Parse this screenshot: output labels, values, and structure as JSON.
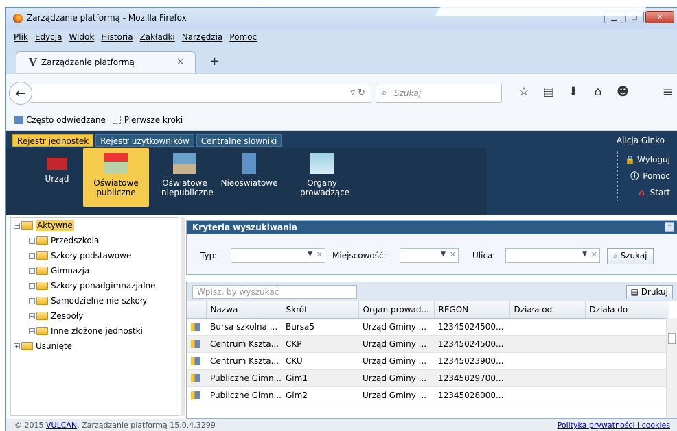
{
  "window": {
    "title": "Zarządzanie platformą - Mozilla Firefox"
  },
  "menubar": [
    "Plik",
    "Edycja",
    "Widok",
    "Historia",
    "Zakładki",
    "Narzędzia",
    "Pomoc"
  ],
  "tab": {
    "favicon": "V",
    "label": "Zarządzanie platformą",
    "close": "×",
    "new": "+"
  },
  "search": {
    "placeholder": "Szukaj"
  },
  "bookmarks": {
    "item1": "Często odwiedzane",
    "item2": "Pierwsze kroki"
  },
  "app": {
    "tabs": [
      "Rejestr jednostek",
      "Rejestr użytkowników",
      "Centralne słowniki"
    ],
    "user": "Alicja Ginko",
    "tiles": [
      "Urząd",
      "Oświatowe publiczne",
      "Oświatowe niepubliczne",
      "Nieoświatowe",
      "Organy prowadzące"
    ],
    "links": {
      "logout": "Wyloguj",
      "help": "Pomoc",
      "start": "Start"
    }
  },
  "tree": [
    {
      "label": "Aktywne",
      "level": 0,
      "sign": "−"
    },
    {
      "label": "Przedszkola",
      "level": 1,
      "sign": "+"
    },
    {
      "label": "Szkoły podstawowe",
      "level": 1,
      "sign": "+"
    },
    {
      "label": "Gimnazja",
      "level": 1,
      "sign": "+"
    },
    {
      "label": "Szkoły ponadgimnazjalne",
      "level": 1,
      "sign": "+"
    },
    {
      "label": "Samodzielne nie-szkoły",
      "level": 1,
      "sign": "+"
    },
    {
      "label": "Zespoły",
      "level": 1,
      "sign": "+"
    },
    {
      "label": "Inne złożone jednostki",
      "level": 1,
      "sign": "+"
    },
    {
      "label": "Usunięte",
      "level": 0,
      "sign": "+"
    }
  ],
  "criteria": {
    "title": "Kryteria wyszukiwania",
    "type_label": "Typ:",
    "city_label": "Miejscowość:",
    "street_label": "Ulica:",
    "search_btn": "Szukaj"
  },
  "grid": {
    "filter_placeholder": "Wpisz, by wyszukać",
    "print": "Drukuj",
    "columns": [
      "Nazwa",
      "Skrót",
      "Organ prowad...",
      "REGON",
      "Działa od",
      "Działa do"
    ],
    "rows": [
      [
        "Bursa szkolna ...",
        "Bursa5",
        "Urząd Gminy ...",
        "12345024500...",
        "",
        ""
      ],
      [
        "Centrum Kszta...",
        "CKP",
        "Urząd Gminy ...",
        "12345024500...",
        "",
        ""
      ],
      [
        "Centrum Kszta...",
        "CKU",
        "Urząd Gminy ...",
        "12345023900...",
        "",
        ""
      ],
      [
        "Publiczne Gimn...",
        "Gim1",
        "Urząd Gminy ...",
        "12345029700...",
        "",
        ""
      ],
      [
        "Publiczne Gimn...",
        "Gim2",
        "Urząd Gminy ...",
        "12345028000...",
        "",
        ""
      ]
    ]
  },
  "footer": {
    "copy": "© 2015",
    "brand": "VULCAN",
    "rest": ", Zarządzanie platformą 15.0.4.3299",
    "privacy": "Polityka prywatności i cookies"
  }
}
